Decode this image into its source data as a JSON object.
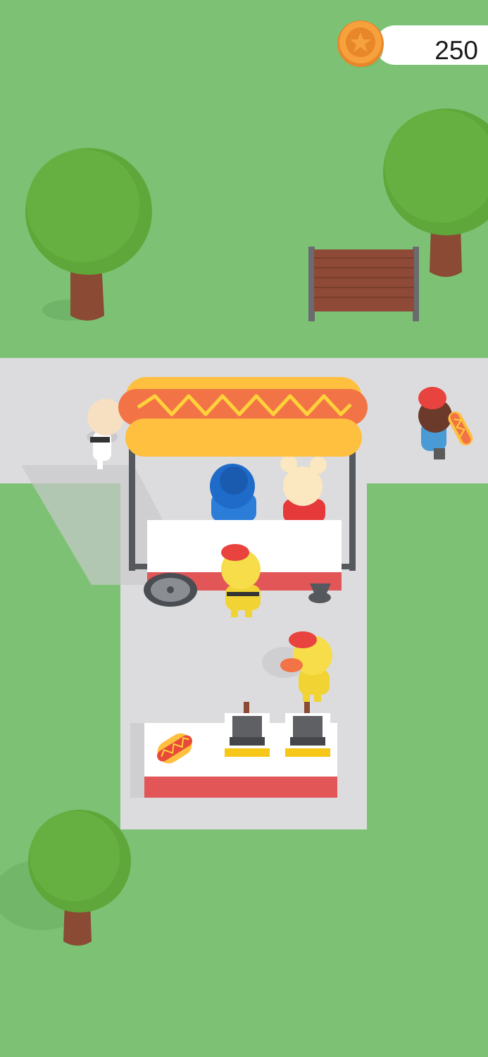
{
  "hud": {
    "coins": "250",
    "coin_icon": "star-coin-icon"
  },
  "colors": {
    "grass": "#7dc274",
    "path": "#dcdcde",
    "tree_leaves": "#5fa73a",
    "tree_trunk": "#8a4a33",
    "bench_wood": "#8e4a36",
    "bun": "#ffbf3f",
    "sausage": "#f27446",
    "mustard": "#ffd23a",
    "cart_stripe": "#e25657",
    "counter_white": "#ffffff",
    "coin_orange": "#f7a13d"
  },
  "scene": {
    "objects": [
      "tree",
      "tree",
      "tree",
      "bench",
      "hot-dog-cart",
      "serving-counter",
      "grill",
      "grill",
      "hot-dog",
      "customer",
      "customer",
      "customer",
      "customer",
      "worker",
      "worker"
    ]
  }
}
